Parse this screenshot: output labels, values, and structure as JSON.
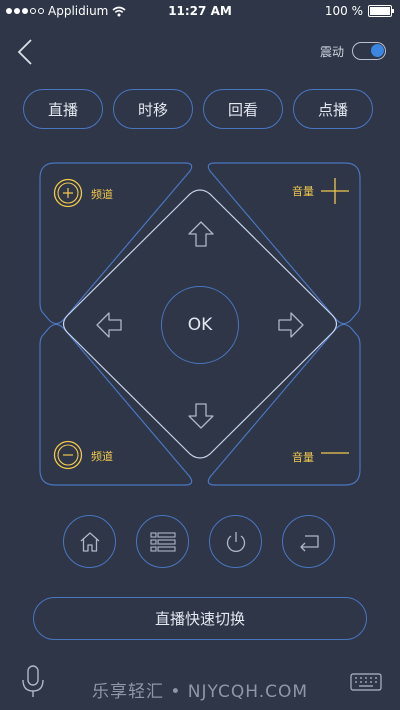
{
  "status_bar": {
    "carrier": "Applidium",
    "time": "11:27 AM",
    "battery": "100 %"
  },
  "header": {
    "vibrate_label": "震动",
    "vibrate_on": true
  },
  "modes": [
    {
      "label": "直播"
    },
    {
      "label": "时移"
    },
    {
      "label": "回看"
    },
    {
      "label": "点播"
    }
  ],
  "pad": {
    "ok_label": "OK",
    "channel_up_label": "频道",
    "channel_down_label": "频道",
    "volume_up_label": "音量",
    "volume_down_label": "音量"
  },
  "functions": [
    {
      "icon": "home-icon"
    },
    {
      "icon": "menu-list-icon"
    },
    {
      "icon": "power-icon"
    },
    {
      "icon": "return-icon"
    }
  ],
  "switch_button": "直播快速切换",
  "footer": {
    "watermark": "乐享轻汇 • NJYCQH.COM"
  },
  "colors": {
    "background": "#2e3647",
    "accent_blue": "#4a76c0",
    "accent_yellow": "#f2c84b",
    "toggle_blue": "#3b86e0"
  }
}
